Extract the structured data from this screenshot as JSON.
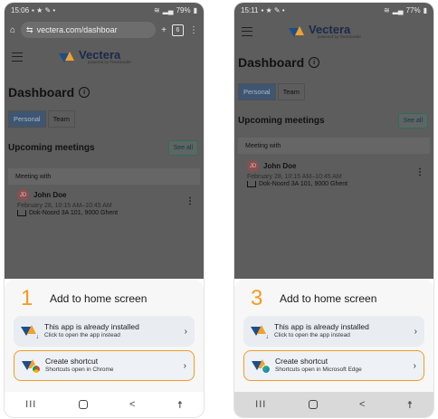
{
  "phones": [
    {
      "status": {
        "time": "15:06",
        "battery": "79%"
      },
      "url": "vectera.com/dashboar",
      "tab_count": "6",
      "brand": {
        "name": "Vectera",
        "sub": "powered by Teamleader"
      },
      "dashboard": {
        "title": "Dashboard",
        "tabs": [
          "Personal",
          "Team"
        ],
        "upcoming": "Upcoming meetings",
        "see_all": "See all",
        "meeting_header": "Meeting with",
        "meeting": {
          "initials": "JD",
          "name": "John Doe",
          "time": "February 28, 10:15 AM–10:45 AM",
          "location": "Dok-Noord 3A 101, 9000 Ghent"
        }
      },
      "sheet": {
        "step": "1",
        "title": "Add to home screen",
        "options": [
          {
            "title": "This app is already installed",
            "sub": "Click to open the app instead"
          },
          {
            "title": "Create shortcut",
            "sub": "Shortcuts open in Chrome"
          }
        ]
      }
    },
    {
      "status": {
        "time": "15:11",
        "battery": "77%"
      },
      "brand": {
        "name": "Vectera",
        "sub": "powered by Teamleader"
      },
      "dashboard": {
        "title": "Dashboard",
        "tabs": [
          "Personal",
          "Team"
        ],
        "upcoming": "Upcoming meetings",
        "see_all": "See all",
        "meeting_header": "Meeting with",
        "meeting": {
          "initials": "JD",
          "name": "John Doe",
          "time": "February 28, 10:15 AM–10:45 AM",
          "location": "Dok-Noord 3A 101, 9000 Ghent"
        }
      },
      "sheet": {
        "step": "3",
        "title": "Add to home screen",
        "options": [
          {
            "title": "This app is already installed",
            "sub": "Click to open the app instead"
          },
          {
            "title": "Create shortcut",
            "sub": "Shortcuts open in Microsoft Edge"
          }
        ]
      }
    }
  ],
  "nav": {
    "recent": "III",
    "back": "<",
    "accessibility": "☨"
  },
  "colors": {
    "accent": "#f39c22",
    "brand_blue": "#1b4f8a",
    "brand_orange": "#f2a12e"
  }
}
